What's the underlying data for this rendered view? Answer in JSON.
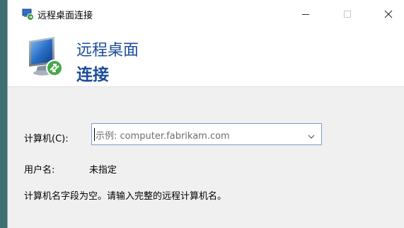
{
  "window": {
    "title": "远程桌面连接"
  },
  "header": {
    "line1": "远程桌面",
    "line2": "连接"
  },
  "form": {
    "computer_label": "计算机(C):",
    "computer_placeholder": "示例: computer.fabrikam.com",
    "user_label": "用户名:",
    "user_value": "未指定",
    "message": "计算机名字段为空。请输入完整的远程计算机名。"
  },
  "icons": {
    "title": "remote-desktop-icon",
    "header": "monitor-icon",
    "minimize": "minimize-icon",
    "maximize": "maximize-icon",
    "close": "close-icon",
    "dropdown": "chevron-down-icon"
  },
  "colors": {
    "header_text": "#1a4d9a",
    "body_background": "#f0f0f0",
    "input_border": "#7a9ec7",
    "placeholder_text": "#6d6d6d"
  }
}
